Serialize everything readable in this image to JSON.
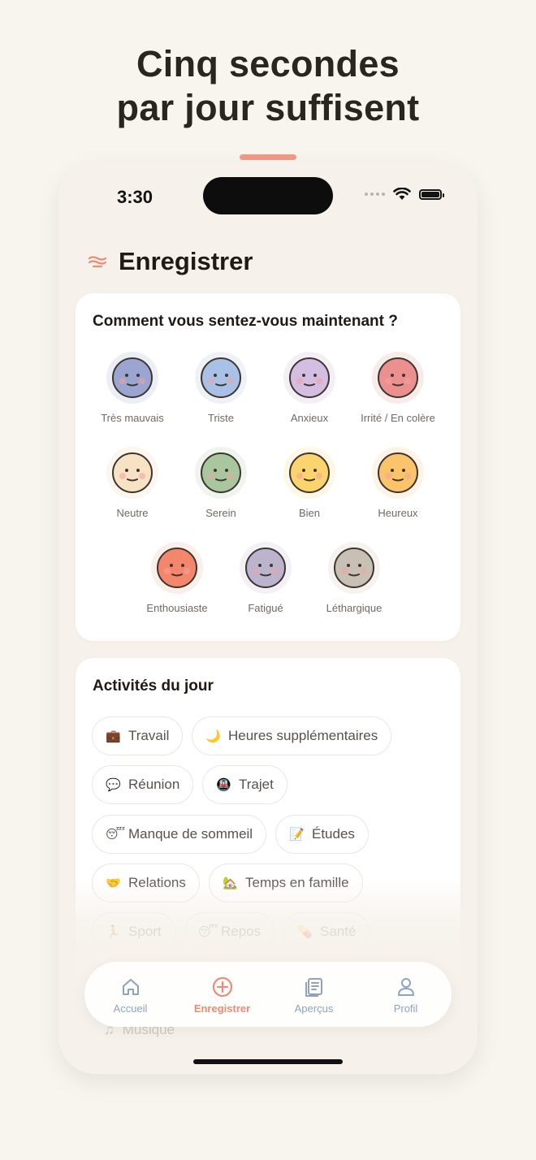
{
  "headline": {
    "line1": "Cinq secondes",
    "line2": "par jour suffisent"
  },
  "status_bar": {
    "time": "3:30"
  },
  "header": {
    "title": "Enregistrer",
    "icon": "wind-lines-icon"
  },
  "mood_section": {
    "title": "Comment vous sentez-vous maintenant ?",
    "moods": [
      {
        "label": "Très mauvais",
        "face": "#9aa6cf",
        "halo": "#eceef5"
      },
      {
        "label": "Triste",
        "face": "#a9c1e6",
        "halo": "#eef2f7"
      },
      {
        "label": "Anxieux",
        "face": "#d3bde0",
        "halo": "#f3eff5"
      },
      {
        "label": "Irrité / En colère",
        "face": "#ec8f8f",
        "halo": "#f8ecea"
      },
      {
        "label": "Neutre",
        "face": "#f7e2c4",
        "halo": "#fbf6ee"
      },
      {
        "label": "Serein",
        "face": "#a9c79f",
        "halo": "#f0f4ee"
      },
      {
        "label": "Bien",
        "face": "#fbd46e",
        "halo": "#fdf7e6"
      },
      {
        "label": "Heureux",
        "face": "#fbc46a",
        "halo": "#fdf4e6"
      },
      {
        "label": "Enthousiaste",
        "face": "#f4866c",
        "halo": "#fbefea"
      },
      {
        "label": "Fatigué",
        "face": "#bcb4cd",
        "halo": "#f3f1f5"
      },
      {
        "label": "Léthargique",
        "face": "#c9c0b5",
        "halo": "#f5f2ef"
      }
    ]
  },
  "activities": {
    "title": "Activités du jour",
    "chips": [
      {
        "icon": "💼",
        "label": "Travail"
      },
      {
        "icon": "🌙",
        "label": "Heures supplémentaires"
      },
      {
        "icon": "💬",
        "label": "Réunion"
      },
      {
        "icon": "🚇",
        "label": "Trajet"
      },
      {
        "icon": "😴",
        "label": "Manque de sommeil"
      },
      {
        "icon": "📝",
        "label": "Études"
      },
      {
        "icon": "🤝",
        "label": "Relations"
      },
      {
        "icon": "🏡",
        "label": "Temps en famille"
      },
      {
        "icon": "🏃",
        "label": "Sport"
      },
      {
        "icon": "😴",
        "label": "Repos"
      },
      {
        "icon": "💊",
        "label": "Santé"
      }
    ],
    "faded_item": {
      "icon": "♫",
      "label": "Musique"
    }
  },
  "tabbar": {
    "tabs": [
      {
        "label": "Accueil",
        "icon": "home-icon"
      },
      {
        "label": "Enregistrer",
        "icon": "add-circle-icon",
        "active": true
      },
      {
        "label": "Aperçus",
        "icon": "insights-icon"
      },
      {
        "label": "Profil",
        "icon": "profile-icon"
      }
    ]
  },
  "colors": {
    "accent": "#ef8a74",
    "inactive_tab": "#8fa3c0",
    "background": "#f8f5ef"
  }
}
